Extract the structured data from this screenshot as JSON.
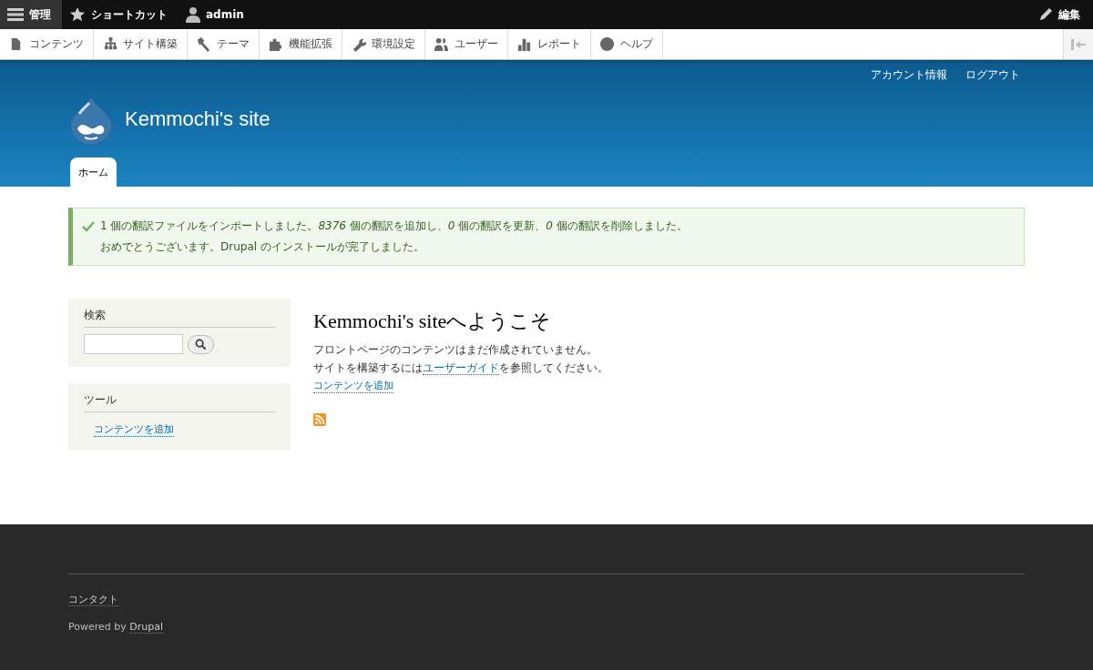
{
  "admin_bar": [
    {
      "label": "管理",
      "selected": true
    },
    {
      "label": "ショートカット",
      "selected": false
    },
    {
      "label": "admin",
      "selected": false
    }
  ],
  "edit_button": "編集",
  "admin_menu": [
    "コンテンツ",
    "サイト構築",
    "テーマ",
    "機能拡張",
    "環境設定",
    "ユーザー",
    "レポート",
    "ヘルプ"
  ],
  "header": {
    "secondary_menu": [
      "アカウント情報",
      "ログアウト"
    ],
    "site_name": "Kemmochi's site",
    "tabs": [
      {
        "label": "ホーム",
        "selected": true
      }
    ]
  },
  "messages": [
    "1 個の翻訳ファイルをインポートしました。*8376* 個の翻訳を追加し、*0* 個の翻訳を更新、*0* 個の翻訳を削除しました。",
    "おめでとうございます。Drupal のインストールが完了しました。"
  ],
  "sidebar": {
    "search": {
      "title": "検索"
    },
    "tools": {
      "title": "ツール",
      "links": [
        "コンテンツを追加"
      ]
    }
  },
  "content": {
    "title": "Kemmochi's siteへようこそ",
    "line_1": "フロントページのコンテンツはまだ作成されていません。",
    "line_2_before": "サイトを構築するには",
    "line_2_link": "ユーザーガイド",
    "line_2_after": "を参照してください。",
    "add_link": "コンテンツを追加"
  },
  "footer": {
    "contact": "コンタクト",
    "powered_by": "Powered by",
    "drupal_link": "Drupal"
  }
}
